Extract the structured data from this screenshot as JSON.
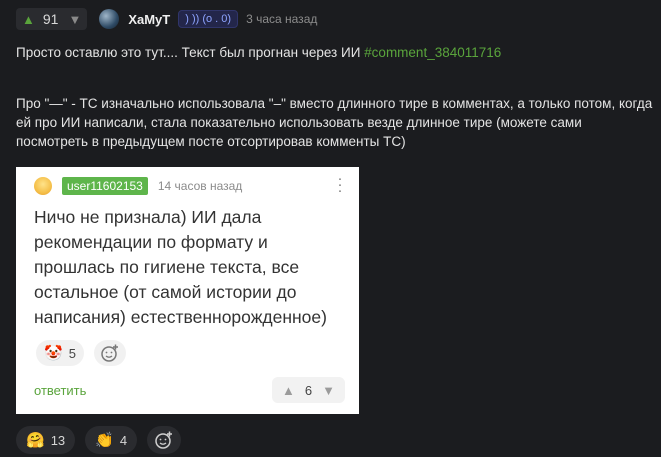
{
  "comment": {
    "score": "91",
    "author": "ХаМуТ",
    "badge": ") )) (o . 0)",
    "time": "3 часа назад",
    "line1_text": "Просто оставлю это тут.... Текст был прогнан через ИИ ",
    "line1_link": "#comment_384011716",
    "paragraph2": "Про \"—\" - ТС изначально использовала \"–\" вместо длинного тире в комментах, а только потом, когда ей про ИИ написали, стала показательно использовать везде длинное тире (можете сами посмотреть в предыдущем посте отсортировав комменты ТС)"
  },
  "embed": {
    "username": "user11602153",
    "time": "14 часов назад",
    "text": "Ничо не признала) ИИ дала рекомендации по формату и прошлась по гигиене текста, все остальное (от самой истории до написания) естественнорожденное)",
    "reaction": {
      "icon": "clown-face-icon",
      "emoji": "🤡",
      "count": "5"
    },
    "reply_label": "ответить",
    "score": "6"
  },
  "reactions": [
    {
      "icon": "smiling-face-icon",
      "emoji": "🤗",
      "count": "13"
    },
    {
      "icon": "clapping-hands-icon",
      "emoji": "👏",
      "count": "4"
    }
  ],
  "colors": {
    "accent_green": "#5aa43c",
    "badge_green": "#5eb54b",
    "background": "#1b1c1f"
  }
}
